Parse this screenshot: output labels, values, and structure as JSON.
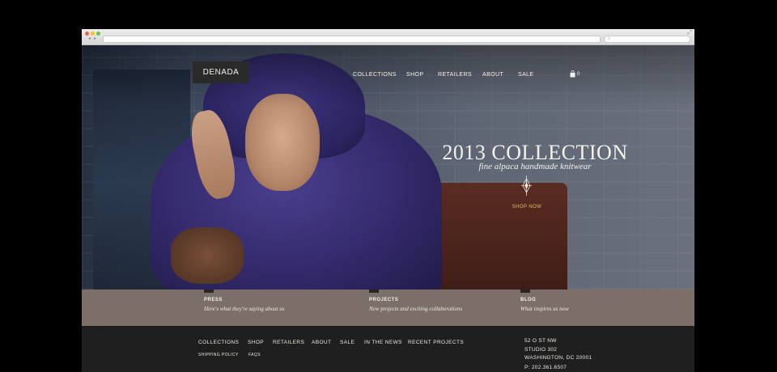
{
  "site": {
    "logo": "DENADA",
    "nav": [
      "COLLECTIONS",
      "SHOP",
      "RETAILERS",
      "ABOUT",
      "SALE"
    ],
    "cart_count": "0"
  },
  "hero": {
    "headline": "2013 COLLECTION",
    "subhead": "fine alpaca handmade knitwear",
    "cta": "SHOP NOW"
  },
  "band": [
    {
      "title": "PRESS",
      "desc": "Here's what they're saying about us"
    },
    {
      "title": "PROJECTS",
      "desc": "New projects and exciting collaborations"
    },
    {
      "title": "BLOG",
      "desc": "What inspires us now"
    }
  ],
  "footer": {
    "nav": [
      "COLLECTIONS",
      "SHOP",
      "RETAILERS",
      "ABOUT",
      "SALE",
      "IN THE NEWS",
      "RECENT PROJECTS"
    ],
    "subnav": [
      "SHIPPING POLICY",
      "FAQS"
    ],
    "address": [
      "52 O ST NW",
      "STUDIO 302",
      "WASHINGTON, DC 20001",
      "P: 202.361.6507"
    ]
  },
  "colors": {
    "accent_cta": "#d8c25e",
    "band": "#847670",
    "footer": "#1f1f1f",
    "logo_bg": "#2a2a2a"
  }
}
